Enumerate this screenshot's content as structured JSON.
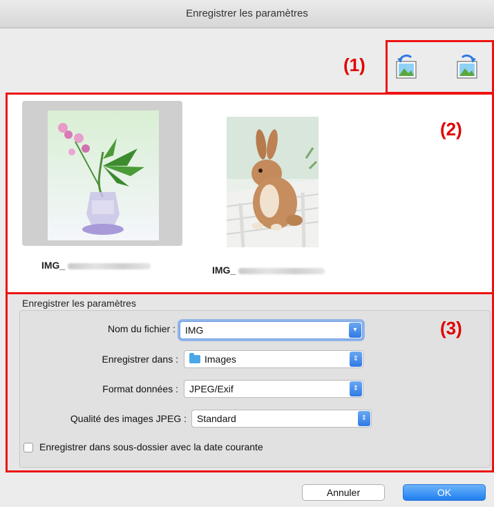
{
  "window": {
    "title": "Enregistrer les paramètres"
  },
  "callouts": {
    "c1": "(1)",
    "c2": "(2)",
    "c3": "(3)"
  },
  "toolbar": {
    "icons": [
      "rotate-left-icon",
      "rotate-right-icon"
    ]
  },
  "thumbnails": [
    {
      "name": "IMG_",
      "subject": "flower-in-vase",
      "selected": true
    },
    {
      "name": "IMG_",
      "subject": "rabbit",
      "selected": false
    }
  ],
  "settings": {
    "group_title": "Enregistrer les paramètres",
    "file_name_label": "Nom du fichier :",
    "file_name_value": "IMG",
    "save_in_label": "Enregistrer dans :",
    "save_in_value": "Images",
    "format_label": "Format données :",
    "format_value": "JPEG/Exif",
    "jpeg_quality_label": "Qualité des images JPEG :",
    "jpeg_quality_value": "Standard",
    "subfolder_label": "Enregistrer dans sous-dossier avec la date courante",
    "subfolder_checked": false
  },
  "buttons": {
    "cancel": "Annuler",
    "ok": "OK"
  },
  "colors": {
    "accent": "#2f7ae5",
    "callout": "#ee1111"
  }
}
